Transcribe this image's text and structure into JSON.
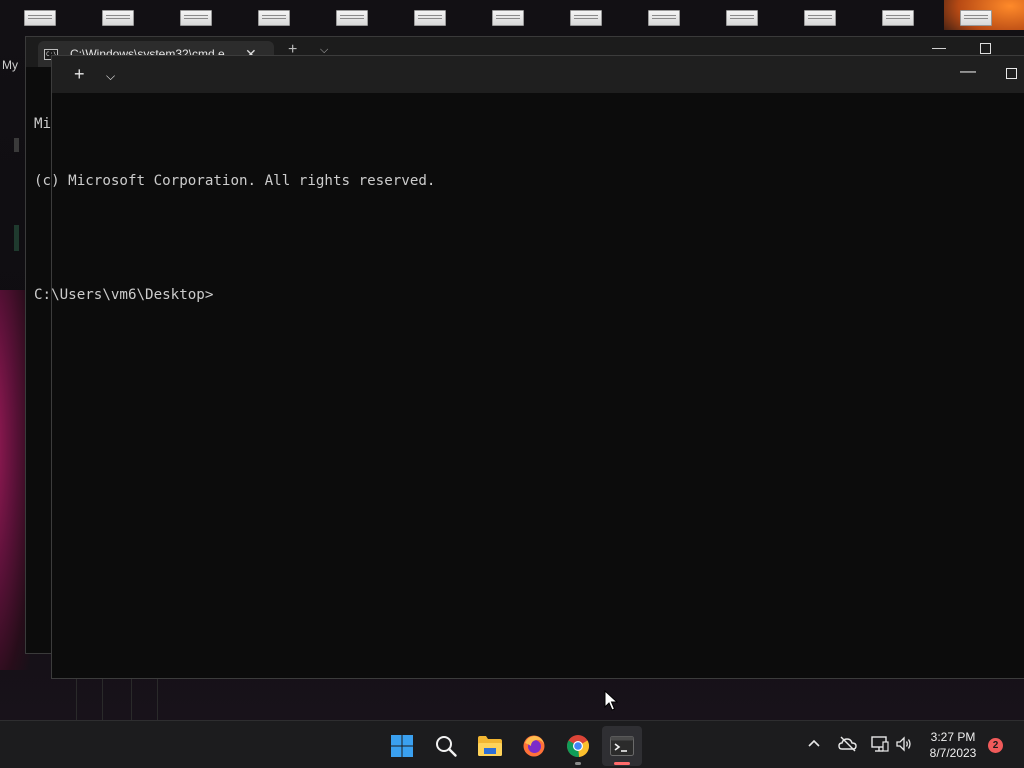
{
  "desktop": {
    "side_label": "My",
    "icon_count": 13
  },
  "back_window": {
    "tab_title": "C:\\Windows\\system32\\cmd.e",
    "tab_close": "✕",
    "new_tab": "+",
    "dropdown": "⌵",
    "minimize": "—"
  },
  "front_window": {
    "new_tab": "+",
    "dropdown": "⌵",
    "minimize": "—"
  },
  "console": {
    "lines": [
      "Mi",
      "(c) Microsoft Corporation. All rights reserved.",
      "",
      "C:\\Users\\vm6\\Desktop>"
    ]
  },
  "taskbar": {
    "apps": [
      {
        "name": "start",
        "icon": "windows-logo-icon"
      },
      {
        "name": "search",
        "icon": "search-icon"
      },
      {
        "name": "file-explorer",
        "icon": "folder-icon"
      },
      {
        "name": "firefox",
        "icon": "firefox-icon"
      },
      {
        "name": "chrome",
        "icon": "chrome-icon"
      },
      {
        "name": "terminal",
        "icon": "terminal-icon"
      }
    ],
    "tray": {
      "chevron": "^"
    },
    "clock": {
      "time": "3:27 PM",
      "date": "8/7/2023"
    },
    "notification_count": "2"
  },
  "colors": {
    "console_bg": "#0c0c0c",
    "console_fg": "#cccccc",
    "taskbar_bg": "#1c1c1e",
    "accent_active": "#ff6b6b"
  }
}
